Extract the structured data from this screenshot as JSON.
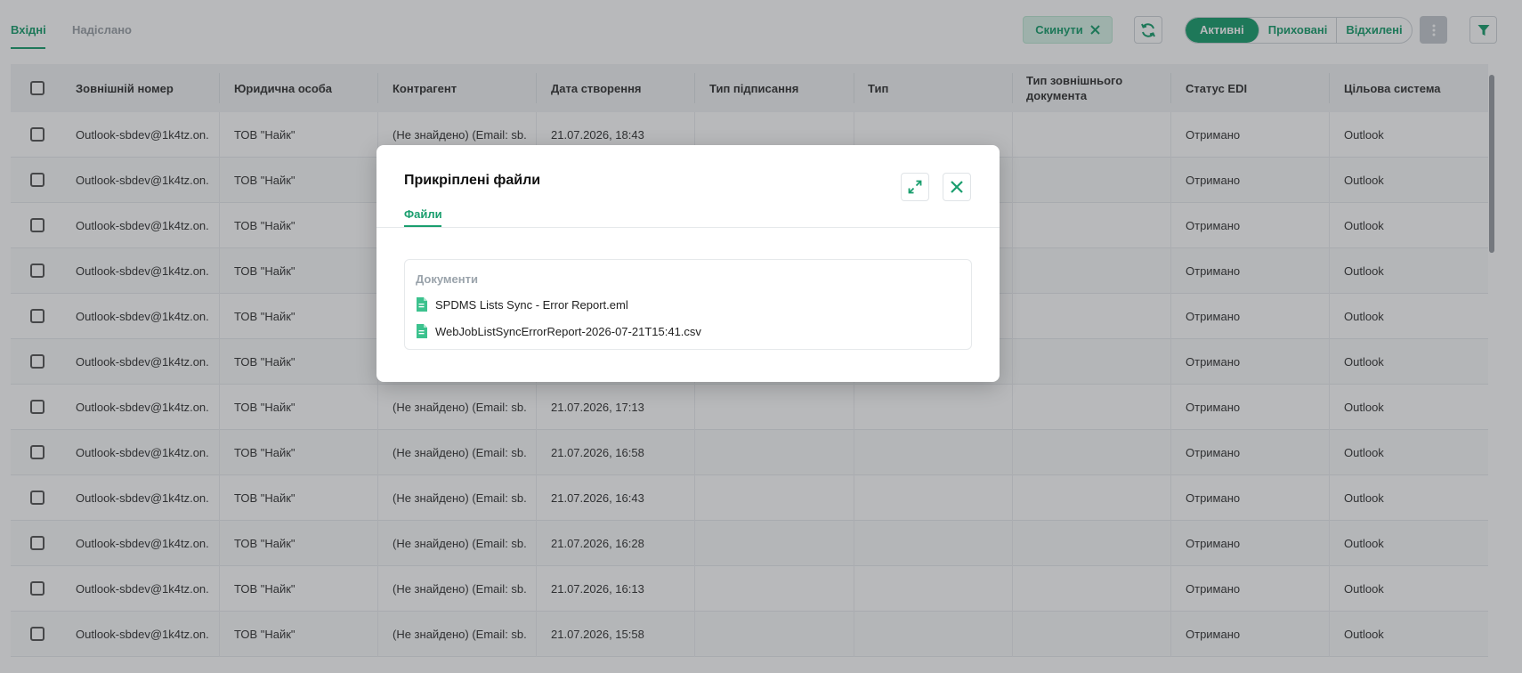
{
  "tabs": [
    {
      "label": "Вхідні",
      "active": true
    },
    {
      "label": "Надіслано",
      "active": false
    }
  ],
  "toolbar": {
    "reset_label": "Скинути",
    "segments": [
      {
        "label": "Активні",
        "active": true
      },
      {
        "label": "Приховані",
        "active": false
      },
      {
        "label": "Відхилені",
        "active": false
      }
    ]
  },
  "table": {
    "columns": [
      "Зовнішній номер",
      "Юридична особа",
      "Контрагент",
      "Дата створення",
      "Тип підписання",
      "Тип",
      "Тип зовнішнього документа",
      "Статус EDI",
      "Цільова система"
    ],
    "rows": [
      [
        "Outlook-sbdev@1k4tz.on...",
        "ТОВ \"Найк\"",
        "(Не знайдено) (Email: sb...",
        "21.07.2026, 18:43",
        "",
        "",
        "",
        "Отримано",
        "Outlook"
      ],
      [
        "Outlook-sbdev@1k4tz.on...",
        "ТОВ \"Найк\"",
        "",
        "",
        "",
        "",
        "",
        "Отримано",
        "Outlook"
      ],
      [
        "Outlook-sbdev@1k4tz.on...",
        "ТОВ \"Найк\"",
        "",
        "",
        "",
        "",
        "",
        "Отримано",
        "Outlook"
      ],
      [
        "Outlook-sbdev@1k4tz.on...",
        "ТОВ \"Найк\"",
        "",
        "",
        "",
        "",
        "",
        "Отримано",
        "Outlook"
      ],
      [
        "Outlook-sbdev@1k4tz.on...",
        "ТОВ \"Найк\"",
        "",
        "",
        "",
        "",
        "",
        "Отримано",
        "Outlook"
      ],
      [
        "Outlook-sbdev@1k4tz.on...",
        "ТОВ \"Найк\"",
        "",
        "",
        "",
        "",
        "",
        "Отримано",
        "Outlook"
      ],
      [
        "Outlook-sbdev@1k4tz.on...",
        "ТОВ \"Найк\"",
        "(Не знайдено) (Email: sb...",
        "21.07.2026, 17:13",
        "",
        "",
        "",
        "Отримано",
        "Outlook"
      ],
      [
        "Outlook-sbdev@1k4tz.on...",
        "ТОВ \"Найк\"",
        "(Не знайдено) (Email: sb...",
        "21.07.2026, 16:58",
        "",
        "",
        "",
        "Отримано",
        "Outlook"
      ],
      [
        "Outlook-sbdev@1k4tz.on...",
        "ТОВ \"Найк\"",
        "(Не знайдено) (Email: sb...",
        "21.07.2026, 16:43",
        "",
        "",
        "",
        "Отримано",
        "Outlook"
      ],
      [
        "Outlook-sbdev@1k4tz.on...",
        "ТОВ \"Найк\"",
        "(Не знайдено) (Email: sb...",
        "21.07.2026, 16:28",
        "",
        "",
        "",
        "Отримано",
        "Outlook"
      ],
      [
        "Outlook-sbdev@1k4tz.on...",
        "ТОВ \"Найк\"",
        "(Не знайдено) (Email: sb...",
        "21.07.2026, 16:13",
        "",
        "",
        "",
        "Отримано",
        "Outlook"
      ],
      [
        "Outlook-sbdev@1k4tz.on...",
        "ТОВ \"Найк\"",
        "(Не знайдено) (Email: sb...",
        "21.07.2026, 15:58",
        "",
        "",
        "",
        "Отримано",
        "Outlook"
      ]
    ]
  },
  "modal": {
    "title": "Прикріплені файли",
    "tab_label": "Файли",
    "section_heading": "Документи",
    "files": [
      {
        "name": "SPDMS Lists Sync - Error Report.eml",
        "icon": "document-icon"
      },
      {
        "name": "WebJobListSyncErrorReport-2026-07-21T15:41.csv",
        "icon": "document-icon"
      }
    ]
  },
  "colors": {
    "accent": "#1a9e6e",
    "overlay": "rgba(40,44,48,0.33)"
  }
}
